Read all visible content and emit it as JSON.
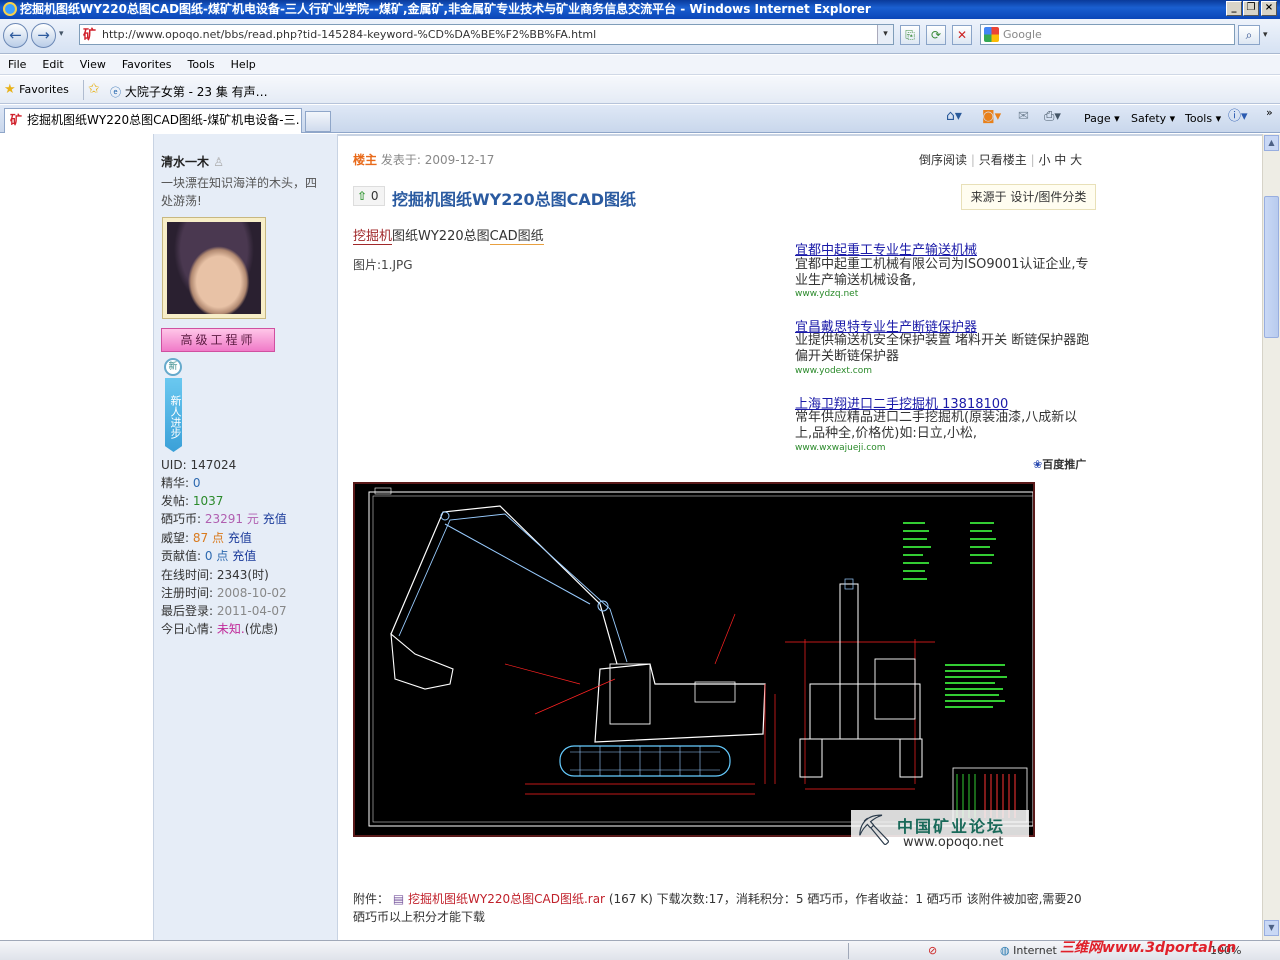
{
  "window": {
    "title": "挖掘机图纸WY220总图CAD图纸-煤矿机电设备-三人行矿业学院--煤矿,金属矿,非金属矿专业技术与矿业商务信息交流平台 - Windows Internet Explorer"
  },
  "address_bar": {
    "url": "http://www.opoqo.net/bbs/read.php?tid-145284-keyword-%CD%DA%BE%F2%BB%FA.html",
    "site_icon": "矿",
    "search_placeholder": "Google"
  },
  "menu": [
    "File",
    "Edit",
    "View",
    "Favorites",
    "Tools",
    "Help"
  ],
  "favorites_bar": {
    "favorites_label": "Favorites",
    "link_label": "大院子女第 - 23 集 有声…"
  },
  "tab": {
    "label": "挖掘机图纸WY220总图CAD图纸-煤矿机电设备-三…"
  },
  "command_bar": {
    "page": "Page",
    "safety": "Safety",
    "tools": "Tools"
  },
  "author": {
    "name": "清水一木",
    "signature": "一块漂在知识海洋的木头，四处游荡!",
    "rank_badge": "高级工程师",
    "newbie_badge_top": "新",
    "newbie_badge_text": "新人进步",
    "stats": {
      "uid_label": "UID:",
      "uid": "147024",
      "essence_label": "精华:",
      "essence": "0",
      "posts_label": "发帖:",
      "posts": "1037",
      "coins_label": "硒巧币:",
      "coins": "23291",
      "coins_unit": "元",
      "recharge": "充值",
      "prestige_label": "威望:",
      "prestige": "87",
      "prestige_unit": "点",
      "contribution_label": "贡献值:",
      "contribution": "0",
      "contribution_unit": "点",
      "online_label": "在线时间:",
      "online": "2343(时)",
      "registered_label": "注册时间:",
      "registered": "2008-10-02",
      "last_login_label": "最后登录:",
      "last_login": "2011-04-07",
      "mood_label": "今日心情:",
      "mood_value": "未知.",
      "mood_extra": "(优虑)"
    }
  },
  "post": {
    "floor": "楼主",
    "posted_at": "发表于: 2009-12-17",
    "options": {
      "reverse": "倒序阅读",
      "only_op": "只看楼主",
      "font_sizes": "小 中 大"
    },
    "vote_count": "0",
    "title": "挖掘机图纸WY220总图CAD图纸",
    "source_label": "来源于 设计/图件分类",
    "body_link_1": "挖掘机",
    "body_text_1": "图纸WY220总图",
    "body_link_2": "CAD",
    "body_text_2": "图纸",
    "image_caption": "图片:1.JPG",
    "watermark_title": "中国矿业论坛",
    "watermark_url": "www.opoqo.net",
    "attachment_label": "附件：",
    "attachment_name": "挖掘机图纸WY220总图CAD图纸.rar",
    "attachment_info": "(167 K) 下载次数:17，消耗积分：5 硒巧币，作者收益：1 硒巧币 该附件被加密,需要20",
    "attachment_info_2": "硒巧币以上积分才能下载"
  },
  "ads": [
    {
      "title": "宜都中起重工专业生产输送机械",
      "text": "宜都中起重工机械有限公司为ISO9001认证企业,专业生产输送机械设备,",
      "url": "www.ydzq.net"
    },
    {
      "title": "宜昌戴思特专业生产断链保护器",
      "text": "业提供输送机安全保护装置 堵料开关 断链保护器跑偏开关断链保护器",
      "url": "www.yodext.com"
    },
    {
      "title": "上海卫翔进口二手挖掘机 13818100",
      "text": "常年供应精品进口二手挖掘机(原装油漆,八成新以上,品种全,价格优)如:日立,小松,",
      "url": "www.wxwajueji.com"
    }
  ],
  "ads_brand": "百度推广",
  "status_bar": {
    "zone": "Internet",
    "zoom": "100%",
    "watermark": "三维网www.3dportal.cn"
  }
}
